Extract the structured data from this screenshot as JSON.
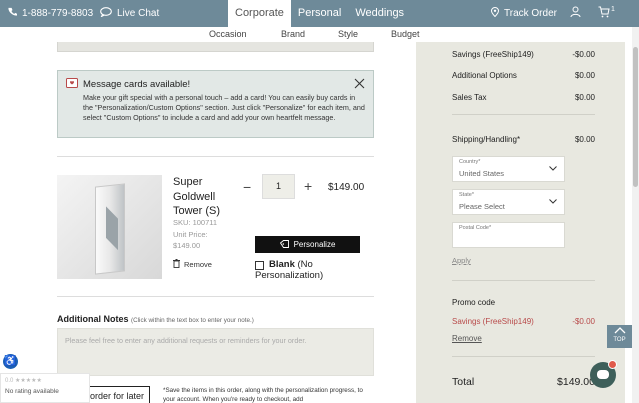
{
  "topbar": {
    "phone": "1-888-779-8803",
    "live_chat": "Live Chat",
    "tabs": [
      {
        "label": "Corporate"
      },
      {
        "label": "Personal"
      },
      {
        "label": "Weddings"
      }
    ],
    "track_order": "Track Order"
  },
  "subnav": {
    "items": [
      "Occasion",
      "Brand",
      "Style",
      "Budget"
    ]
  },
  "message_card": {
    "title": "Message cards available!",
    "body": "Make your gift special with a personal touch – add a card! You can easily buy cards in the \"Personalization/Custom Options\" section. Just click \"Personalize\" for each item, and select \"Custom Options\" to include a card and add your own heartfelt message."
  },
  "product": {
    "name": "Super Goldwell Tower (S)",
    "sku": "SKU: 100711",
    "unit_price_label": "Unit Price:",
    "unit_price": "$149.00",
    "remove": "Remove",
    "quantity": "1",
    "price": "$149.00",
    "personalize": "Personalize",
    "blank_label": "Blank",
    "blank_note": "(No",
    "blank_note2": "Personalization)"
  },
  "notes": {
    "label": "Additional Notes",
    "hint": "(Click within the text box to enter your note.)",
    "placeholder": "Please feel free to enter any additional requests or reminders for your order."
  },
  "save": {
    "button": "order for later",
    "note": "*Save the items in this order, along with the personalization progress, to your account. When you're ready to checkout, add"
  },
  "rating": {
    "score": "0.0 ★★★★★",
    "text": "No rating available"
  },
  "summary": {
    "rows": [
      {
        "label": "Savings (FreeShip149)",
        "value": "-$0.00"
      },
      {
        "label": "Additional Options",
        "value": "$0.00"
      },
      {
        "label": "Sales Tax",
        "value": "$0.00"
      },
      {
        "label": "Shipping/Handling*",
        "value": "$0.00"
      }
    ],
    "country_label": "Country*",
    "country_value": "United States",
    "state_label": "State*",
    "state_value": "Please Select",
    "postal_label": "Postal Code*",
    "apply": "Apply",
    "promo_label": "Promo code",
    "promo_savings_label": "Savings (FreeShip149)",
    "promo_savings_value": "-$0.00",
    "remove": "Remove",
    "total_label": "Total",
    "total_value": "$149.00"
  },
  "top_button": "TOP",
  "colors": {
    "topbar": "#6e8a99",
    "summary_bg": "#e8e8e0",
    "savings_red": "#b84a4a"
  }
}
